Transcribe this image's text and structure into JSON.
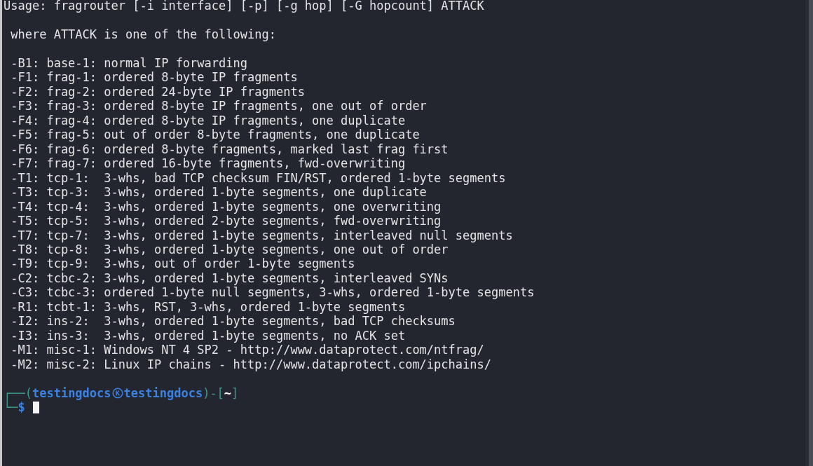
{
  "terminal": {
    "usage": "Usage: fragrouter [-i interface] [-p] [-g hop] [-G hopcount] ATTACK",
    "heading": " where ATTACK is one of the following:",
    "options": [
      " -B1: base-1: normal IP forwarding",
      " -F1: frag-1: ordered 8-byte IP fragments",
      " -F2: frag-2: ordered 24-byte IP fragments",
      " -F3: frag-3: ordered 8-byte IP fragments, one out of order",
      " -F4: frag-4: ordered 8-byte IP fragments, one duplicate",
      " -F5: frag-5: out of order 8-byte fragments, one duplicate",
      " -F6: frag-6: ordered 8-byte fragments, marked last frag first",
      " -F7: frag-7: ordered 16-byte fragments, fwd-overwriting",
      " -T1: tcp-1:  3-whs, bad TCP checksum FIN/RST, ordered 1-byte segments",
      " -T3: tcp-3:  3-whs, ordered 1-byte segments, one duplicate",
      " -T4: tcp-4:  3-whs, ordered 1-byte segments, one overwriting",
      " -T5: tcp-5:  3-whs, ordered 2-byte segments, fwd-overwriting",
      " -T7: tcp-7:  3-whs, ordered 1-byte segments, interleaved null segments",
      " -T8: tcp-8:  3-whs, ordered 1-byte segments, one out of order",
      " -T9: tcp-9:  3-whs, out of order 1-byte segments",
      " -C2: tcbc-2: 3-whs, ordered 1-byte segments, interleaved SYNs",
      " -C3: tcbc-3: ordered 1-byte null segments, 3-whs, ordered 1-byte segments",
      " -R1: tcbt-1: 3-whs, RST, 3-whs, ordered 1-byte segments",
      " -I2: ins-2:  3-whs, ordered 1-byte segments, bad TCP checksums",
      " -I3: ins-3:  3-whs, ordered 1-byte segments, no ACK set",
      " -M1: misc-1: Windows NT 4 SP2 - http://www.dataprotect.com/ntfrag/",
      " -M2: misc-2: Linux IP chains - http://www.dataprotect.com/ipchains/"
    ],
    "prompt": {
      "open": "┌──(",
      "user": "testingdocs",
      "host": "testingdocs",
      "mid": ")-[",
      "cwd": "~",
      "close": "]",
      "corner": "└─",
      "symbol": "$"
    }
  }
}
